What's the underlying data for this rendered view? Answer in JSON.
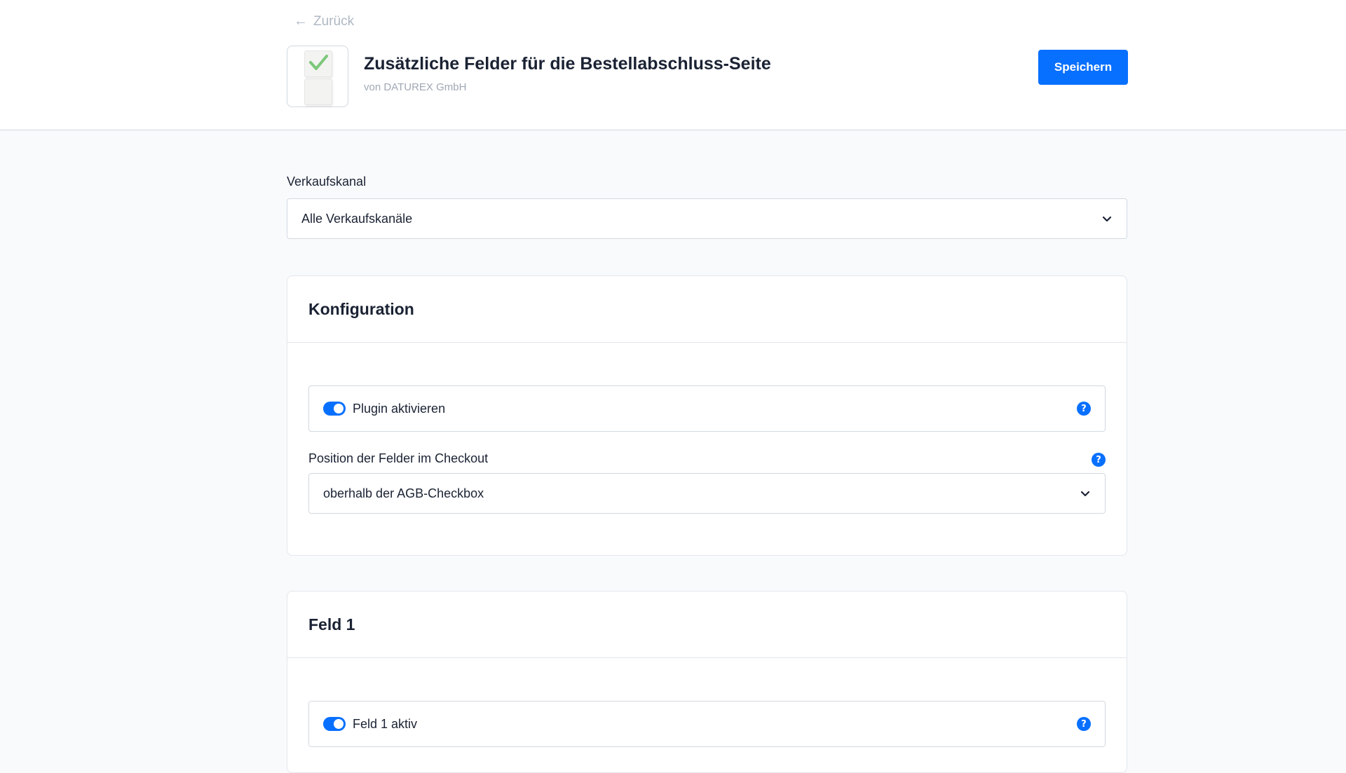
{
  "header": {
    "back_label": "Zurück",
    "title": "Zusätzliche Felder für die Bestellabschluss-Seite",
    "vendor": "von DATUREX GmbH",
    "save_label": "Speichern"
  },
  "sales_channel": {
    "label": "Verkaufskanal",
    "value": "Alle Verkaufskanäle"
  },
  "configuration_card": {
    "title": "Konfiguration",
    "plugin_toggle": {
      "label": "Plugin aktivieren",
      "enabled": true
    },
    "position_field": {
      "label": "Position der Felder im Checkout",
      "value": "oberhalb der AGB-Checkbox"
    }
  },
  "field1_card": {
    "title": "Feld 1",
    "active_toggle": {
      "label": "Feld 1 aktiv",
      "enabled": true
    }
  },
  "icons": {
    "help": "?",
    "logo": "checkbox-check-icon"
  },
  "colors": {
    "accent": "#0870ff",
    "check_green": "#7cc87a",
    "page_background": "#f9fafc"
  }
}
